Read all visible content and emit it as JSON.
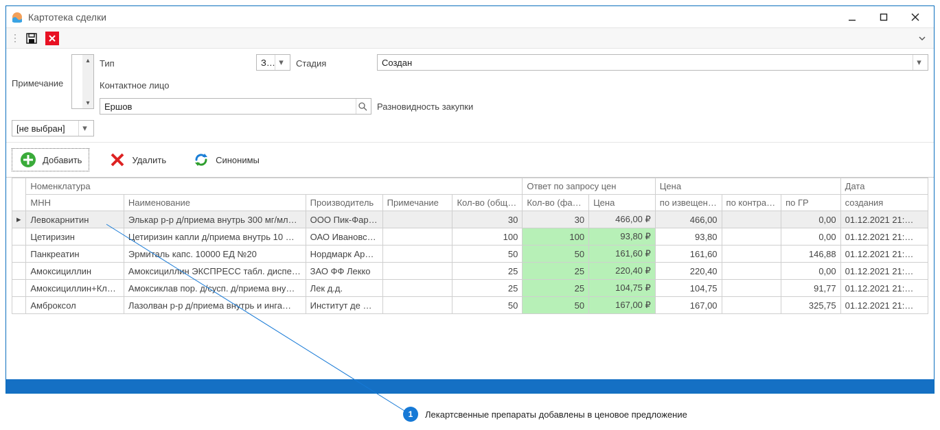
{
  "window": {
    "title": "Картотека сделки"
  },
  "form": {
    "type_label": "Тип",
    "type_value": "Запрос цен",
    "stage_label": "Стадия",
    "stage_value": "Создан",
    "note_label": "Примечание",
    "contact_label": "Контактное лицо",
    "contact_value": "Ершов",
    "variety_label": "Разновидность закупки",
    "variety_value": "[не выбран]"
  },
  "actions": {
    "add": "Добавить",
    "del": "Удалить",
    "syn": "Синонимы"
  },
  "grid": {
    "group_nomenclature": "Номенклатура",
    "group_response": "Ответ по запросу цен",
    "group_price": "Цена",
    "group_date": "Дата",
    "col_mnn": "МНН",
    "col_name": "Наименование",
    "col_manuf": "Производитель",
    "col_note": "Примечание",
    "col_qty_total": "Кол-во (общ…",
    "col_qty_fact": "Кол-во (фак…",
    "col_price": "Цена",
    "col_by_notice": "по извещен…",
    "col_by_contract": "по контра…",
    "col_by_gr": "по ГР",
    "col_created": "создания",
    "rows": [
      {
        "sel": true,
        "hl": false,
        "mnn": "Левокарнитин",
        "name": "Элькар р-р д/приема внутрь 300 мг/мл…",
        "manuf": "ООО Пик-Фар…",
        "note": "",
        "qty_total": "30",
        "qty_fact": "30",
        "price": "466,00 ₽",
        "p_notice": "466,00",
        "p_contract": "",
        "p_gr": "0,00",
        "created": "01.12.2021 21:…"
      },
      {
        "sel": false,
        "hl": true,
        "mnn": "Цетиризин",
        "name": "Цетиризин капли д/приема внутрь 10 …",
        "manuf": "ОАО Ивановс…",
        "note": "",
        "qty_total": "100",
        "qty_fact": "100",
        "price": "93,80 ₽",
        "p_notice": "93,80",
        "p_contract": "",
        "p_gr": "0,00",
        "created": "01.12.2021 21:…"
      },
      {
        "sel": false,
        "hl": true,
        "mnn": "Панкреатин",
        "name": "Эрмиталь капс. 10000 ЕД №20",
        "manuf": "Нордмарк Ар…",
        "note": "",
        "qty_total": "50",
        "qty_fact": "50",
        "price": "161,60 ₽",
        "p_notice": "161,60",
        "p_contract": "",
        "p_gr": "146,88",
        "created": "01.12.2021 21:…"
      },
      {
        "sel": false,
        "hl": true,
        "mnn": "Амоксициллин",
        "name": "Амоксициллин ЭКСПРЕСС табл. диспе…",
        "manuf": "ЗАО ФФ Лекко",
        "note": "",
        "qty_total": "25",
        "qty_fact": "25",
        "price": "220,40 ₽",
        "p_notice": "220,40",
        "p_contract": "",
        "p_gr": "0,00",
        "created": "01.12.2021 21:…"
      },
      {
        "sel": false,
        "hl": true,
        "mnn": "Амоксициллин+Кл…",
        "name": "Амоксиклав пор. д/сусп. д/приема вну…",
        "manuf": "Лек д.д.",
        "note": "",
        "qty_total": "25",
        "qty_fact": "25",
        "price": "104,75 ₽",
        "p_notice": "104,75",
        "p_contract": "",
        "p_gr": "91,77",
        "created": "01.12.2021 21:…"
      },
      {
        "sel": false,
        "hl": true,
        "mnn": "Амброксол",
        "name": "Лазолван р-р д/приема внутрь и инга…",
        "manuf": "Институт де …",
        "note": "",
        "qty_total": "50",
        "qty_fact": "50",
        "price": "167,00 ₽",
        "p_notice": "167,00",
        "p_contract": "",
        "p_gr": "325,75",
        "created": "01.12.2021 21:…"
      }
    ]
  },
  "callout": {
    "num": "1",
    "text": "Лекартсвенные препараты добавлены в ценовое предложение"
  }
}
